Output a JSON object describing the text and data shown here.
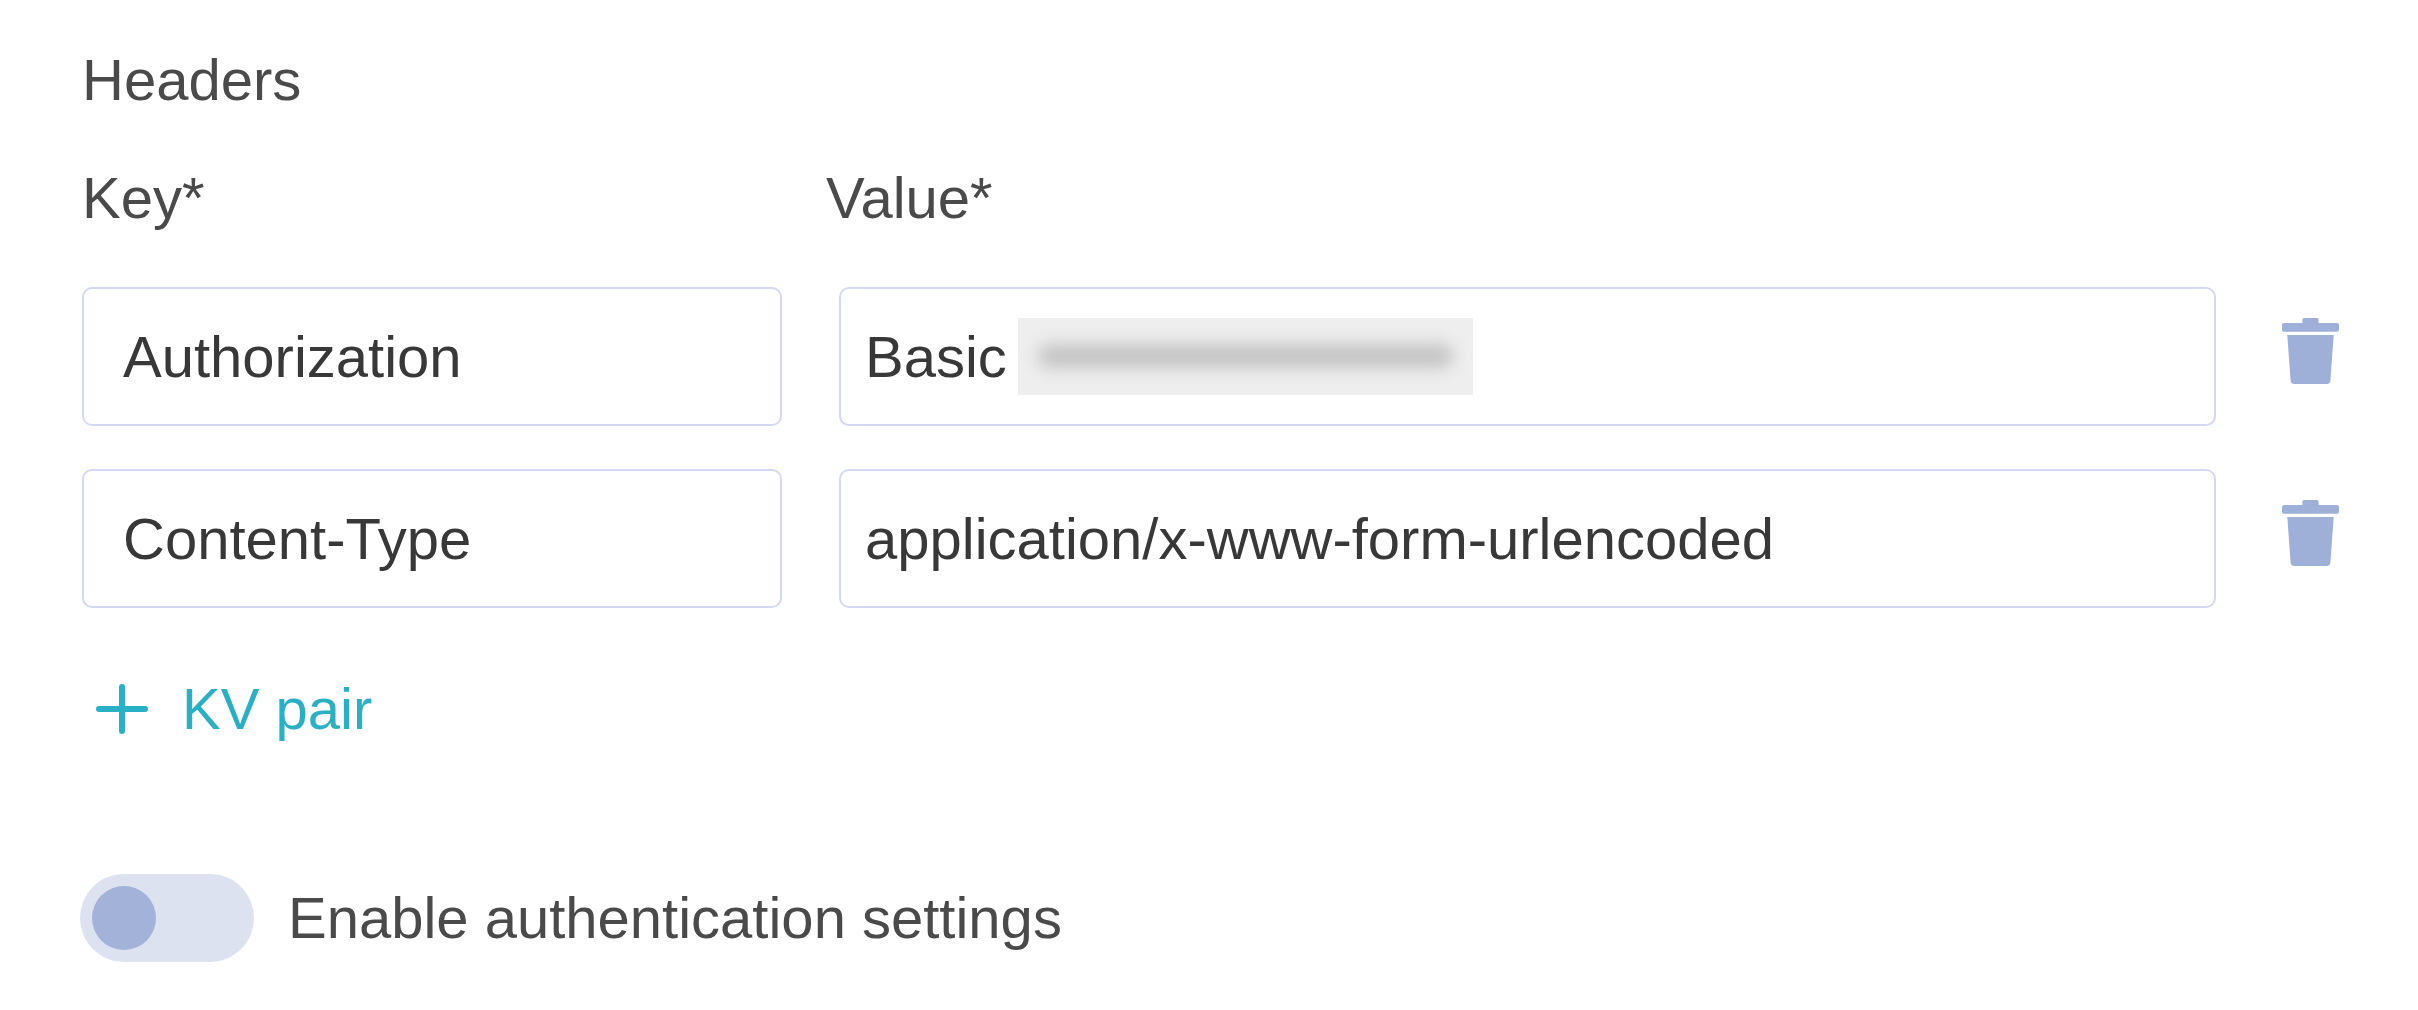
{
  "section": {
    "title": "Headers"
  },
  "columns": [
    {
      "label": "Key*"
    },
    {
      "label": "Value*"
    }
  ],
  "rows": [
    {
      "key": "Authorization",
      "value": "Basic",
      "redacted": true
    },
    {
      "key": "Content-Type",
      "value": "application/x-www-form-urlencoded",
      "redacted": false
    }
  ],
  "add_button": {
    "label": "KV pair"
  },
  "toggle": {
    "label": "Enable authentication settings",
    "on": false
  }
}
